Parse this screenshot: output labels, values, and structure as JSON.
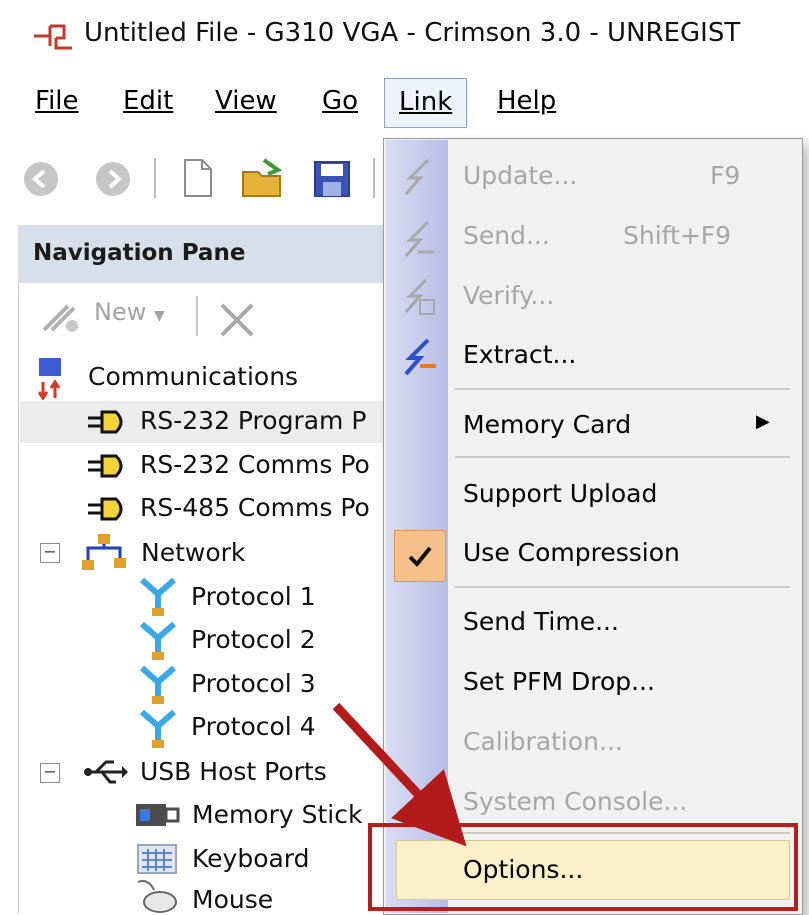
{
  "window": {
    "title": "Untitled File - G310 VGA - Crimson 3.0 - UNREGIST"
  },
  "menubar": {
    "items": [
      "File",
      "Edit",
      "View",
      "Go",
      "Link",
      "Help"
    ]
  },
  "nav": {
    "header": "Navigation Pane",
    "new_label": "New",
    "tree": {
      "communications": "Communications",
      "rs232_program": "RS-232 Program P",
      "rs232_comms": "RS-232 Comms Po",
      "rs485_comms": "RS-485 Comms Po",
      "network": "Network",
      "protocol1": "Protocol 1",
      "protocol2": "Protocol 2",
      "protocol3": "Protocol 3",
      "protocol4": "Protocol 4",
      "usb_host_ports": "USB Host Ports",
      "memory_stick": "Memory Stick",
      "keyboard": "Keyboard",
      "mouse": "Mouse"
    }
  },
  "link_menu": {
    "update": {
      "label": "Update...",
      "shortcut": "F9"
    },
    "send": {
      "label": "Send...",
      "shortcut": "Shift+F9"
    },
    "verify": {
      "label": "Verify..."
    },
    "extract": {
      "label": "Extract..."
    },
    "memory_card": {
      "label": "Memory Card"
    },
    "support_upload": {
      "label": "Support Upload"
    },
    "use_compression": {
      "label": "Use Compression"
    },
    "send_time": {
      "label": "Send Time..."
    },
    "set_pfm_drop": {
      "label": "Set PFM Drop..."
    },
    "calibration": {
      "label": "Calibration..."
    },
    "system_console": {
      "label": "System Console..."
    },
    "options": {
      "label": "Options..."
    }
  },
  "colors": {
    "highlight_red": "#b51e1e",
    "arrow_red": "#b31b1b"
  }
}
